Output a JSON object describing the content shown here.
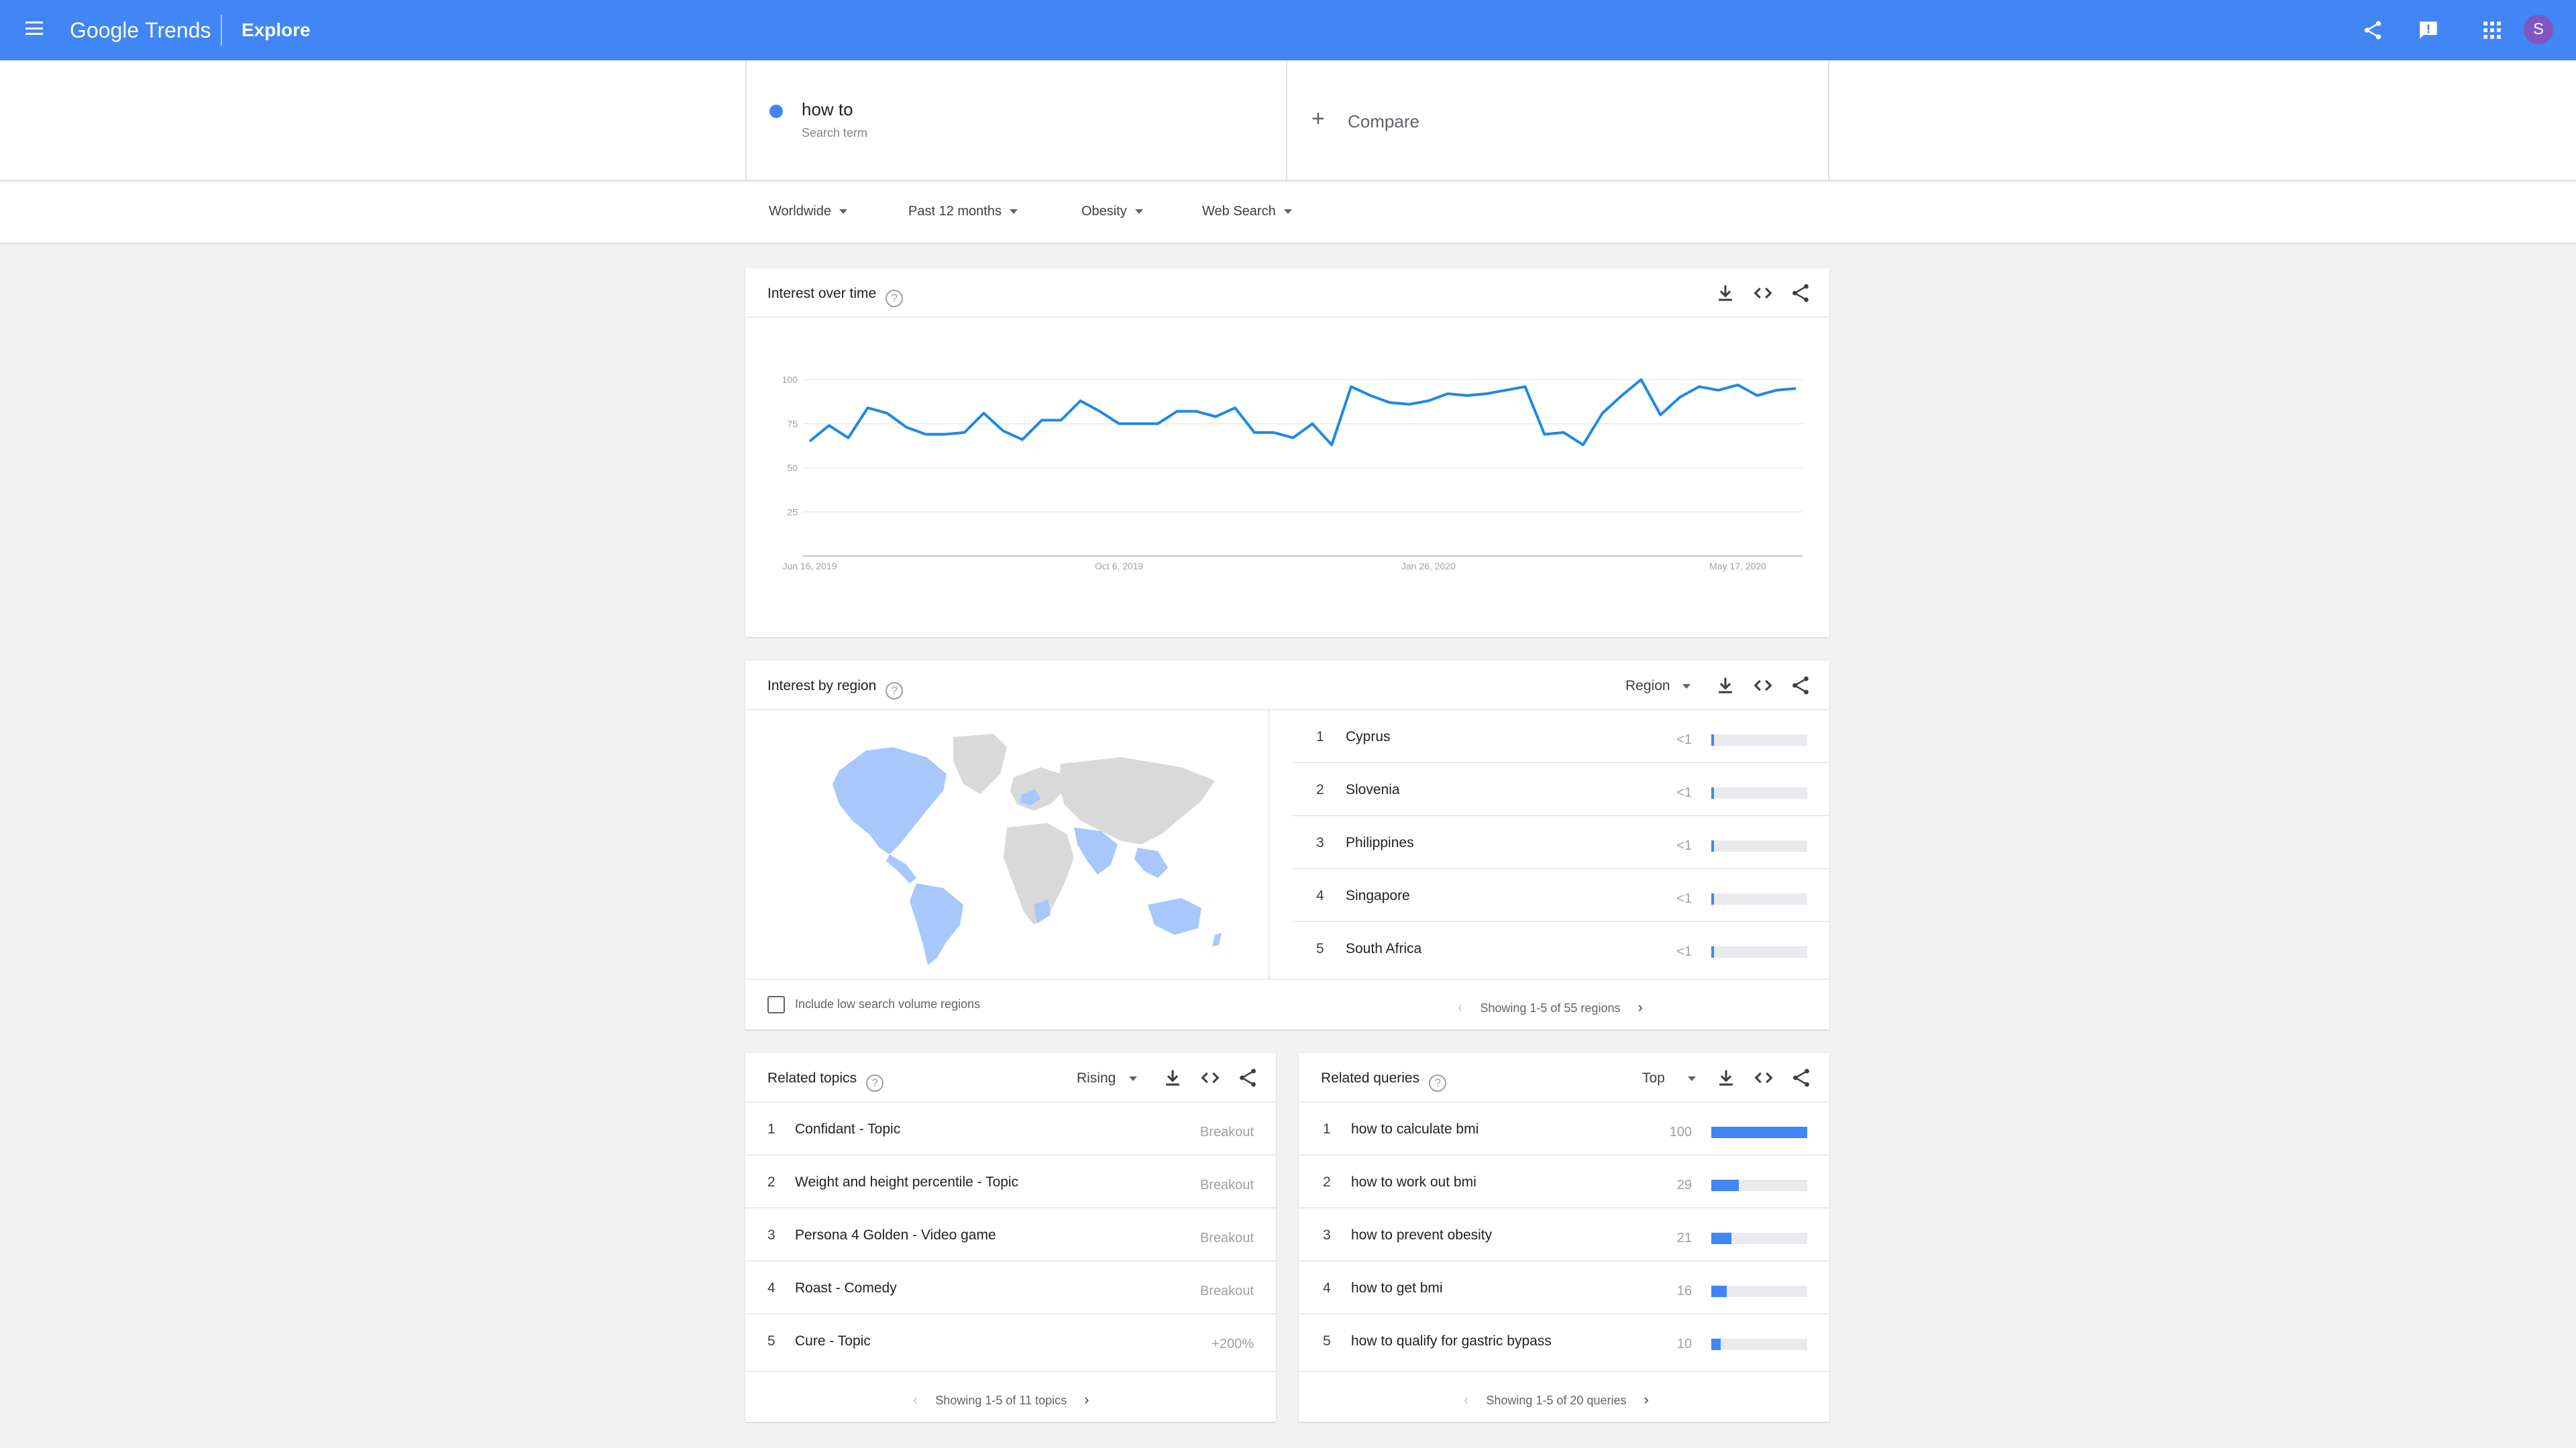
{
  "header": {
    "brand_primary": "Google",
    "brand_secondary": "Trends",
    "page": "Explore",
    "avatar_letter": "S",
    "icons": [
      "menu-icon",
      "share-icon",
      "feedback-icon",
      "apps-icon"
    ]
  },
  "search": {
    "term": "how to",
    "term_type": "Search term",
    "compare_label": "Compare"
  },
  "filters": {
    "region": "Worldwide",
    "time": "Past 12 months",
    "category": "Obesity",
    "property": "Web Search"
  },
  "interest_over_time": {
    "title": "Interest over time",
    "chart_data": {
      "type": "line",
      "title": "Interest over time",
      "ylim": [
        0,
        100
      ],
      "yticks": [
        "100",
        "75",
        "50",
        "25"
      ],
      "xticks": [
        "Jun 16, 2019",
        "Oct 6, 2019",
        "Jan 26, 2020",
        "May 17, 2020"
      ],
      "color": "#1e88e5",
      "series": [
        {
          "values": [
            65,
            74,
            67,
            84,
            81,
            73,
            69,
            69,
            70,
            81,
            71,
            66,
            77,
            77,
            88,
            82,
            75,
            75,
            75,
            82,
            82,
            79,
            84,
            70,
            70,
            67,
            75,
            63,
            96,
            91,
            87,
            86,
            88,
            92,
            91,
            92,
            94,
            96,
            69,
            70,
            63,
            81,
            91,
            100,
            80,
            90,
            96,
            94,
            97,
            91,
            94,
            95
          ]
        }
      ]
    }
  },
  "interest_by_region": {
    "title": "Interest by region",
    "dropdown": "Region",
    "items": [
      {
        "rank": "1",
        "name": "Cyprus",
        "value": "<1",
        "pct": 2
      },
      {
        "rank": "2",
        "name": "Slovenia",
        "value": "<1",
        "pct": 2
      },
      {
        "rank": "3",
        "name": "Philippines",
        "value": "<1",
        "pct": 2
      },
      {
        "rank": "4",
        "name": "Singapore",
        "value": "<1",
        "pct": 2
      },
      {
        "rank": "5",
        "name": "South Africa",
        "value": "<1",
        "pct": 2
      }
    ],
    "checkbox_label": "Include low search volume regions",
    "pager": "Showing 1-5 of 55 regions"
  },
  "related_topics": {
    "title": "Related topics",
    "dropdown": "Rising",
    "items": [
      {
        "rank": "1",
        "name": "Confidant - Topic",
        "value": "Breakout"
      },
      {
        "rank": "2",
        "name": "Weight and height percentile - Topic",
        "value": "Breakout"
      },
      {
        "rank": "3",
        "name": "Persona 4 Golden - Video game",
        "value": "Breakout"
      },
      {
        "rank": "4",
        "name": "Roast - Comedy",
        "value": "Breakout"
      },
      {
        "rank": "5",
        "name": "Cure - Topic",
        "value": "+200%"
      }
    ],
    "pager": "Showing 1-5 of 11 topics"
  },
  "related_queries": {
    "title": "Related queries",
    "dropdown": "Top",
    "items": [
      {
        "rank": "1",
        "name": "how to calculate bmi",
        "value": "100",
        "pct": 100
      },
      {
        "rank": "2",
        "name": "how to work out bmi",
        "value": "29",
        "pct": 29
      },
      {
        "rank": "3",
        "name": "how to prevent obesity",
        "value": "21",
        "pct": 21
      },
      {
        "rank": "4",
        "name": "how to get bmi",
        "value": "16",
        "pct": 16
      },
      {
        "rank": "5",
        "name": "how to qualify for gastric bypass",
        "value": "10",
        "pct": 10
      }
    ],
    "pager": "Showing 1-5 of 20 queries"
  },
  "colors": {
    "brand_blue": "#4285f4",
    "line_blue": "#1e88e5",
    "map_light_blue": "#a8c7fa",
    "map_gray": "#d9d9d9"
  }
}
